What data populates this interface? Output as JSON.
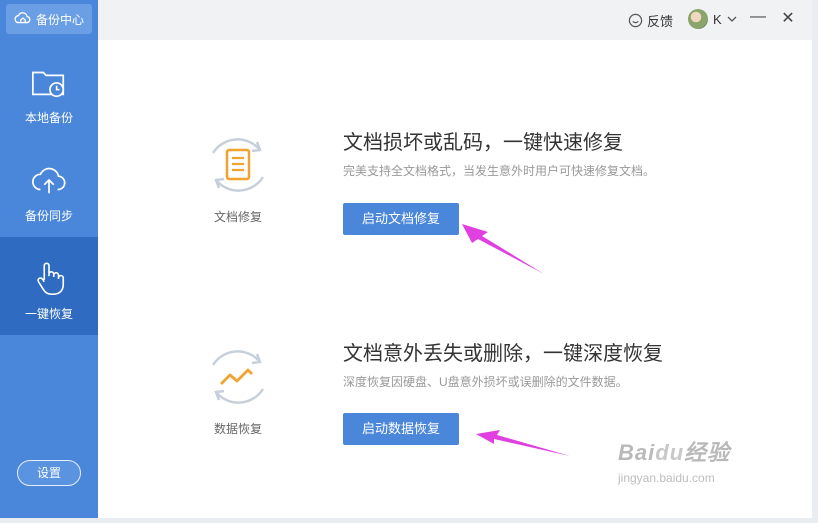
{
  "app": {
    "brand_label": "备份中心"
  },
  "sidebar": {
    "items": [
      {
        "label": "本地备份",
        "icon": "folder-clock-icon"
      },
      {
        "label": "备份同步",
        "icon": "cloud-upload-icon"
      },
      {
        "label": "一键恢复",
        "icon": "hand-pointer-icon",
        "active": true
      }
    ],
    "settings_label": "设置"
  },
  "topbar": {
    "feedback_label": "反馈",
    "user_name": "K",
    "minimize": "—",
    "close": "✕"
  },
  "features": [
    {
      "icon_label": "文档修复",
      "title": "文档损坏或乱码，一键快速修复",
      "description": "完美支持全文档格式，当发生意外时用户可快速修复文档。",
      "button_label": "启动文档修复"
    },
    {
      "icon_label": "数据恢复",
      "title": "文档意外丢失或删除，一键深度恢复",
      "description": "深度恢复因硬盘、U盘意外损坏或误删除的文件数据。",
      "button_label": "启动数据恢复"
    }
  ],
  "watermark": {
    "logo_a": "Bai",
    "logo_b": "du",
    "logo_c": "经验",
    "url": "jingyan.baidu.com"
  },
  "colors": {
    "sidebar": "#4a87db",
    "active": "#2f6bc0",
    "button": "#4a87db",
    "annotation_arrow": "#e040e0"
  }
}
